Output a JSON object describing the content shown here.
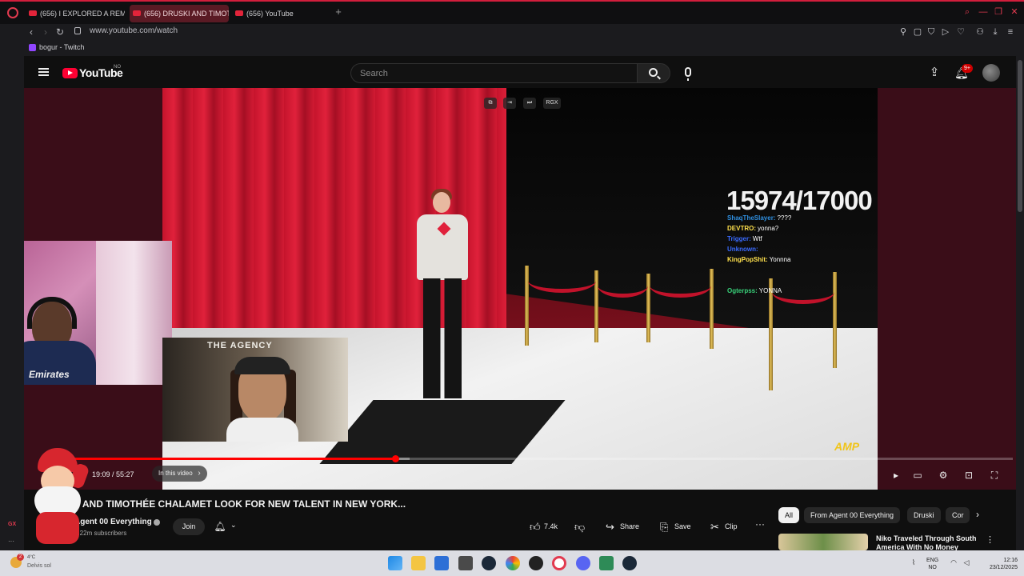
{
  "browser": {
    "tabs": [
      {
        "label": "(656) I EXPLORED A REMO",
        "active": false
      },
      {
        "label": "(656) DRUSKI AND TIMOT",
        "active": true
      },
      {
        "label": "(656) YouTube",
        "active": false
      }
    ],
    "new_tab_label": "+",
    "url": "www.youtube.com/watch",
    "bookmark": "bogur - Twitch"
  },
  "youtube": {
    "logo_text": "YouTube",
    "country_code": "NO",
    "search_placeholder": "Search",
    "notification_count": "9+"
  },
  "player": {
    "counter": "15974/17000",
    "chat": [
      {
        "user": "ShaqTheSlayer:",
        "msg": "????",
        "color": "#2f8fe0"
      },
      {
        "user": "DEVTRO:",
        "msg": "yonna?",
        "color": "#ffe14d"
      },
      {
        "user": "Trigger:",
        "msg": "Wtf",
        "color": "#3a6bff"
      },
      {
        "user": "Unknown:",
        "msg": "",
        "color": "#3a6bff"
      },
      {
        "user": "KingPopShit:",
        "msg": "Yonnna",
        "color": "#ffe14d"
      },
      {
        "user": "",
        "msg": "",
        "color": "#8a4bd6"
      },
      {
        "user": "",
        "msg": "",
        "color": "#c83ad6"
      },
      {
        "user": "Ogterpss:",
        "msg": "YONNA",
        "color": "#39d27a"
      }
    ],
    "overlay_sign": "THE AGENCY",
    "jersey_text": "Emirates",
    "current_time": "19:09",
    "duration": "55:27",
    "time_display": "19:09 / 55:27",
    "progress_fraction": 0.345,
    "buffer_fraction": 0.36,
    "in_this_video_label": "In this video",
    "watermark": "AMP"
  },
  "video": {
    "title": "KI AND TIMOTHÉE CHALAMET LOOK FOR NEW TALENT IN NEW YORK...",
    "channel": "Agent 00 Everything",
    "subscribers": "1.22m subscribers",
    "join_label": "Join",
    "likes": "7.4k",
    "share_label": "Share",
    "save_label": "Save",
    "clip_label": "Clip"
  },
  "sidebar": {
    "chips": [
      {
        "label": "All",
        "selected": true
      },
      {
        "label": "From Agent 00 Everything",
        "selected": false
      },
      {
        "label": "Druski",
        "selected": false
      },
      {
        "label": "Cor",
        "selected": false
      }
    ],
    "recommendation_title": "Niko Traveled Through South America With No Money"
  },
  "opera_sidebar": {
    "gx_label": "GX",
    "more": "···"
  },
  "taskbar": {
    "weather_badge": "2",
    "weather_temp": "4°C",
    "weather_desc": "Delvis sol",
    "language": "ENG",
    "region": "NO",
    "time": "12:16",
    "date": "23/12/2025"
  },
  "colors": {
    "accent": "#ff0000",
    "opera": "#e23a4f",
    "chip_bg": "#272727"
  }
}
